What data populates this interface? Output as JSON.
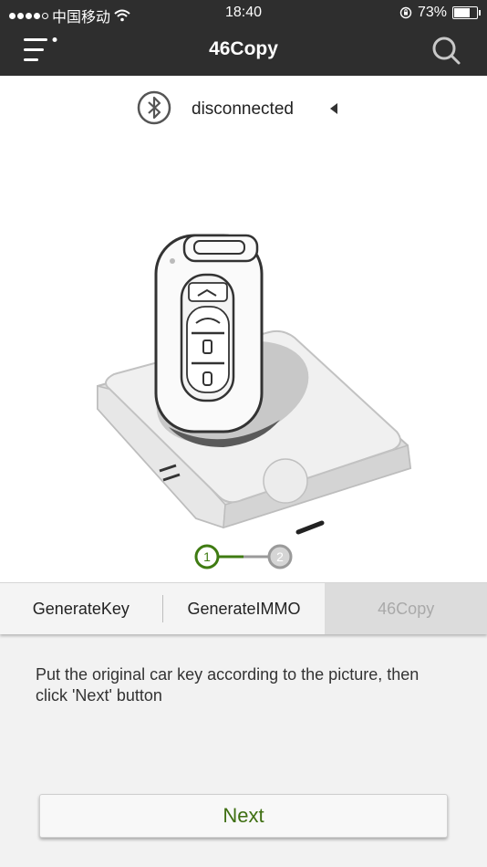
{
  "status_bar": {
    "carrier": "中国移动",
    "time": "18:40",
    "battery": "73%"
  },
  "nav": {
    "title": "46Copy",
    "menu_icon": "menu-icon",
    "search_icon": "search-icon"
  },
  "device": {
    "status": "disconnected",
    "bluetooth_icon": "bluetooth-icon"
  },
  "steps": {
    "items": [
      "1",
      "2"
    ],
    "current": 1,
    "active_color": "#3f7b12",
    "inactive_color": "#9a9a9a"
  },
  "tabs": [
    {
      "label": "GenerateKey",
      "selected": false
    },
    {
      "label": "GenerateIMMO",
      "selected": false
    },
    {
      "label": "46Copy",
      "selected": true
    }
  ],
  "instruction": "Put the original car key according to the picture, then click 'Next' button",
  "next_label": "Next",
  "colors": {
    "nav_bg": "#2e2e2e",
    "accent": "#3f6f12"
  }
}
